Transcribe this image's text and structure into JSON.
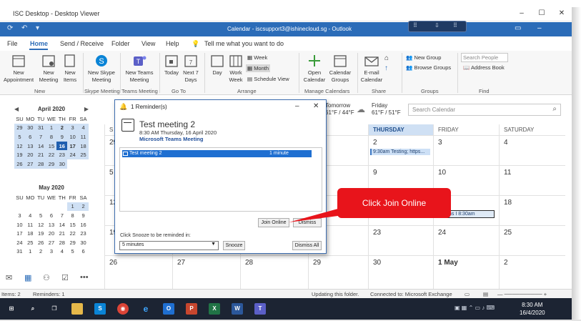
{
  "viewer": {
    "title": "ISC Desktop - Desktop Viewer"
  },
  "outlook": {
    "window_title": "Calendar - iscsupport3@ishinecloud.sg - Outlook"
  },
  "menu": {
    "items": [
      "File",
      "Home",
      "Send / Receive",
      "Folder",
      "View",
      "Help"
    ],
    "tell_me": "Tell me what you want to do"
  },
  "ribbon": {
    "new_appointment": "New\nAppointment",
    "new_meeting": "New\nMeeting",
    "new_items": "New\nItems",
    "group_new": "New",
    "new_skype_meeting": "New Skype\nMeeting",
    "group_skype": "Skype Meeting",
    "new_teams_meeting": "New Teams\nMeeting",
    "group_teams": "Teams Meeting",
    "today": "Today",
    "next7": "Next 7\nDays",
    "group_goto": "Go To",
    "day": "Day",
    "work_week": "Work\nWeek",
    "week": "Week",
    "month": "Month",
    "schedule_view": "Schedule View",
    "group_arrange": "Arrange",
    "open_calendar": "Open\nCalendar",
    "calendar_groups": "Calendar\nGroups",
    "group_manage": "Manage Calendars",
    "email_calendar": "E-mail\nCalendar",
    "group_share": "Share",
    "new_group": "New Group",
    "browse_groups": "Browse Groups",
    "group_groups": "Groups",
    "search_people_placeholder": "Search People",
    "address_book": "Address Book",
    "group_find": "Find"
  },
  "mini_cal_1": {
    "title": "April 2020",
    "dow": [
      "SU",
      "MO",
      "TU",
      "WE",
      "TH",
      "FR",
      "SA"
    ],
    "weeks": [
      [
        "29",
        "30",
        "31",
        "1",
        "2",
        "3",
        "4"
      ],
      [
        "5",
        "6",
        "7",
        "8",
        "9",
        "10",
        "11"
      ],
      [
        "12",
        "13",
        "14",
        "15",
        "16",
        "17",
        "18"
      ],
      [
        "19",
        "20",
        "21",
        "22",
        "23",
        "24",
        "25"
      ],
      [
        "26",
        "27",
        "28",
        "29",
        "30",
        "",
        ""
      ]
    ]
  },
  "mini_cal_2": {
    "title": "May 2020",
    "dow": [
      "SU",
      "MO",
      "TU",
      "WE",
      "TH",
      "FR",
      "SA"
    ],
    "weeks": [
      [
        "",
        "",
        "",
        "",
        "",
        "1",
        "2"
      ],
      [
        "3",
        "4",
        "5",
        "6",
        "7",
        "8",
        "9"
      ],
      [
        "10",
        "11",
        "12",
        "13",
        "14",
        "15",
        "16"
      ],
      [
        "17",
        "18",
        "19",
        "20",
        "21",
        "22",
        "23"
      ],
      [
        "24",
        "25",
        "26",
        "27",
        "28",
        "29",
        "30"
      ],
      [
        "31",
        "1",
        "2",
        "3",
        "4",
        "5",
        "6"
      ]
    ]
  },
  "weather": {
    "tomorrow_label": "Tomorrow",
    "tomorrow_temp": "61°F / 44°F",
    "friday_label": "Friday",
    "friday_temp": "61°F / 51°F"
  },
  "search_calendar_placeholder": "Search Calendar",
  "calendar": {
    "day_headers": [
      "S",
      "",
      "",
      "",
      "THURSDAY",
      "FRIDAY",
      "SATURDAY"
    ],
    "rows": [
      [
        "29",
        "",
        "",
        "",
        "2",
        "3",
        "4"
      ],
      [
        "5",
        "",
        "",
        "",
        "9",
        "10",
        "11"
      ],
      [
        "12",
        "",
        "",
        "",
        "",
        "",
        "18"
      ],
      [
        "19",
        "",
        "",
        "",
        "23",
        "24",
        "25"
      ],
      [
        "26",
        "27",
        "28",
        "29",
        "30",
        "1 May",
        "2"
      ]
    ],
    "event_thu": "9:30am Testing; https...",
    "event_fri": "t Teams I 8:30am"
  },
  "status": {
    "items": "Items: 2",
    "reminders": "Reminders: 1",
    "updating": "Updating this folder.",
    "connected": "Connected to: Microsoft Exchange"
  },
  "taskbar": {
    "time": "8:30 AM",
    "date": "16/4/2020"
  },
  "reminder": {
    "window_title": "1 Reminder(s)",
    "meeting_title": "Test meeting 2",
    "meeting_time": "8:30 AM Thursday, 16 April 2020",
    "meeting_location": "Microsoft Teams Meeting",
    "list_item_name": "Test meeting 2",
    "list_item_due": "1 minute",
    "join_online": "Join Online",
    "dismiss": "Dismiss",
    "snooze_label": "Click Snooze to be reminded in:",
    "snooze_value": "5 minutes",
    "snooze": "Snooze",
    "dismiss_all": "Dismiss All"
  },
  "callout": {
    "text": "Click Join Online"
  }
}
